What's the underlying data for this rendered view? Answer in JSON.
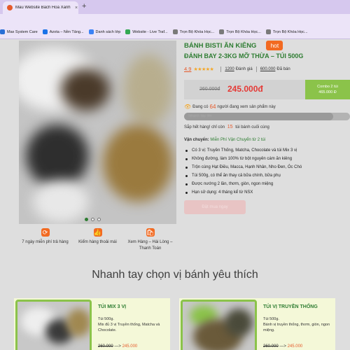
{
  "browser": {
    "tab_title": "Mẫu Website Bách Hoá Xanh",
    "close": "×",
    "new_tab": "+",
    "bookmarks": [
      {
        "label": "Max System Care",
        "color": "#2a6fd6"
      },
      {
        "label": "Azota – Nền Tảng...",
        "color": "#1a73e8"
      },
      {
        "label": "Danh sách lớp",
        "color": "#3b82f6"
      },
      {
        "label": "Website - Live Traf...",
        "color": "#34a853"
      },
      {
        "label": "Trọn Bộ Khóa Học...",
        "color": "#7a7a7a"
      },
      {
        "label": "Trọn Bộ Khóa Học...",
        "color": "#7a7a7a"
      },
      {
        "label": "Trọn Bộ Khóa Học...",
        "color": "#7a7a7a"
      }
    ]
  },
  "product": {
    "title_line1": "BÁNH BISTI ĂN KIÊNG",
    "hot_badge": "hot",
    "title_line2": "ĐÁNH BAY 2-3KG MỠ THỪA – TÚI 500G",
    "rating": "4.9",
    "stars": "★★★★★",
    "reviews_count": "1200",
    "reviews_label": "Đánh giá",
    "sold_count": "600.000",
    "sold_label": "Đã bán",
    "old_price": "260.000đ",
    "new_price": "245.000đ",
    "combo_line1": "Combo 2 túi",
    "combo_line2": "465.000 Đ",
    "viewers_prefix": "Đang có",
    "viewers_count": "64",
    "viewers_suffix": "người đang xem sản phẩm này",
    "progress_label": "Nhanh tay lên",
    "progress_fraction": 0.9,
    "lowstock_prefix": "Sắp hết hàng! chỉ còn",
    "lowstock_count": "15",
    "lowstock_suffix": "túi bánh cuối cùng",
    "shipping_label": "Vận chuyển:",
    "shipping_value": "Miễn Phí Vận Chuyển từ 2 túi",
    "bullets": [
      "Có 3 vị: Truyền Thống, Matcha, Chocolate và túi Mix 3 vị",
      "Không đường, làm 100% từ bột nguyên cám ăn kiêng",
      "Trộn cùng Hạt Điều, Macca, Hạnh Nhân, Nho Đen, Óc Chó",
      "Túi 500g, có thể ăn thay cả bữa chính, bữa phụ",
      "Được nướng 2 lần, thơm, giòn, ngon miệng",
      "Hạn sử dụng: 4 tháng kể từ NSX"
    ],
    "buy_button": "Đặt mua ngay"
  },
  "features": [
    {
      "icon": "refresh-icon",
      "glyph": "⟳",
      "label": "7 ngày miễn phí trả hàng"
    },
    {
      "icon": "thumbs-up-icon",
      "glyph": "👍",
      "label": "Kiểm hàng thoải mái"
    },
    {
      "icon": "shopping-bag-icon",
      "glyph": "🛍",
      "label": "Xem Hàng – Hài Lòng – Thanh Toán"
    }
  ],
  "section_title": "Nhanh tay chọn vị bánh yêu thích",
  "cards": [
    {
      "name": "TÚI MIX 3 VỊ",
      "desc": "Túi 500g.\nMix đủ 3 vị Truyền thống, Matcha và Chocolate.",
      "old_price": "260.000",
      "arrow": "—>",
      "new_price": "245.000"
    },
    {
      "name": "TÚI VỊ TRUYỀN THỐNG",
      "desc": "Túi 500g.\nBánh vị truyền thống, thơm, giòn, ngon miệng.",
      "old_price": "260.000",
      "arrow": "—>",
      "new_price": "245.000"
    }
  ],
  "colors": {
    "brand_green": "#2e7d32",
    "accent_orange": "#f26a21",
    "price_red": "#e53935",
    "combo_green": "#8bc34a"
  }
}
